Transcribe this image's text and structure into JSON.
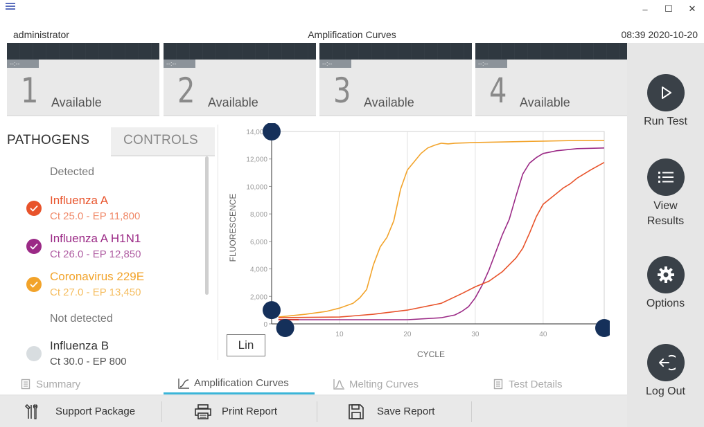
{
  "window": {
    "user": "administrator",
    "title": "Amplification Curves",
    "datetime": "08:39 2020-10-20",
    "controls": {
      "minimize": "–",
      "maximize": "☐",
      "close": "✕"
    }
  },
  "modules": [
    {
      "tag": "--:--",
      "number": "1",
      "status": "Available"
    },
    {
      "tag": "--:--",
      "number": "2",
      "status": "Available"
    },
    {
      "tag": "--:--",
      "number": "3",
      "status": "Available"
    },
    {
      "tag": "--:--",
      "number": "4",
      "status": "Available"
    }
  ],
  "sidebar": {
    "run_test": "Run Test",
    "view_results_1": "View",
    "view_results_2": "Results",
    "options": "Options",
    "log_out": "Log Out"
  },
  "tabs": {
    "pathogens": "PATHOGENS",
    "controls": "CONTROLS"
  },
  "list": {
    "detected_header": "Detected",
    "not_detected_header": "Not detected",
    "items": [
      {
        "name": "Influenza A",
        "values": "Ct 25.0  -  EP 11,800",
        "color": "#e8532b"
      },
      {
        "name": "Influenza A H1N1",
        "values": "Ct 26.0  -  EP 12,850",
        "color": "#9b2a86"
      },
      {
        "name": "Coronavirus 229E",
        "values": "Ct 27.0  -  EP 13,450",
        "color": "#f2a32a"
      },
      {
        "name": "Influenza B",
        "values": "Ct 30.0  -  EP 800",
        "color": "#333333"
      }
    ]
  },
  "scale_button": "Lin",
  "chart_data": {
    "type": "line",
    "xlabel": "CYCLE",
    "ylabel": "FLUORESCENCE",
    "xlim": [
      0,
      49
    ],
    "ylim": [
      0,
      14000
    ],
    "x_ticks": [
      "10",
      "20",
      "30",
      "40"
    ],
    "y_ticks": [
      "0",
      "2,000",
      "4,000",
      "6,000",
      "8,000",
      "10,000",
      "12,000",
      "14,000"
    ],
    "series": [
      {
        "color": "#f2a32a",
        "x": [
          1,
          5,
          8,
          10,
          12,
          13,
          14,
          15,
          16,
          17,
          18,
          19,
          20,
          21,
          22,
          23,
          24,
          25,
          26,
          27,
          30,
          35,
          40,
          45,
          49
        ],
        "y": [
          500,
          700,
          900,
          1150,
          1500,
          1900,
          2500,
          4300,
          5600,
          6300,
          7500,
          9800,
          11200,
          11800,
          12400,
          12800,
          13000,
          13150,
          13100,
          13150,
          13200,
          13250,
          13300,
          13350,
          13350
        ]
      },
      {
        "color": "#9b2a86",
        "x": [
          1,
          10,
          20,
          25,
          27,
          28,
          29,
          30,
          31,
          32,
          33,
          34,
          35,
          36,
          37,
          38,
          39,
          40,
          42,
          45,
          49
        ],
        "y": [
          300,
          300,
          300,
          450,
          650,
          900,
          1250,
          1900,
          2800,
          3900,
          5200,
          6500,
          7600,
          9300,
          10900,
          11700,
          12100,
          12400,
          12600,
          12750,
          12800
        ]
      },
      {
        "color": "#e8532b",
        "x": [
          1,
          10,
          15,
          20,
          25,
          28,
          30,
          32,
          34,
          36,
          37,
          38,
          39,
          40,
          41,
          42,
          43,
          44,
          45,
          47,
          49
        ],
        "y": [
          450,
          500,
          700,
          1000,
          1500,
          2200,
          2700,
          3100,
          3800,
          4800,
          5500,
          6600,
          7800,
          8700,
          9100,
          9500,
          9900,
          10200,
          10600,
          11200,
          11750
        ]
      }
    ],
    "grid": "vertical"
  },
  "view_tabs": {
    "summary": "Summary",
    "amplification": "Amplification Curves",
    "melting": "Melting Curves",
    "details": "Test Details"
  },
  "toolbar": {
    "support": "Support Package",
    "print": "Print Report",
    "save": "Save Report"
  }
}
